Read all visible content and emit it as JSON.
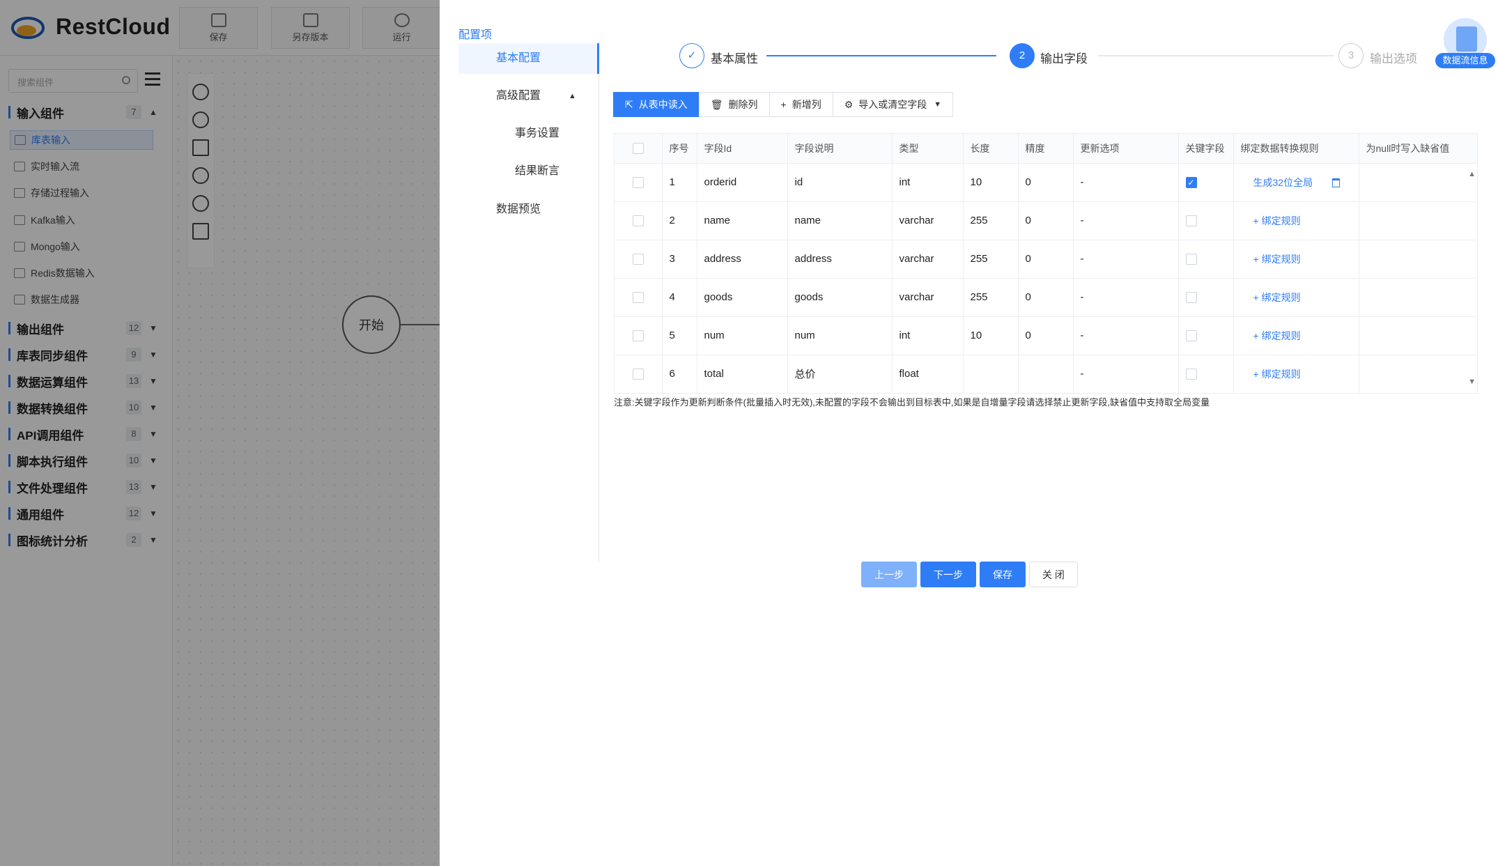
{
  "app": {
    "name": "RestCloud",
    "toolbar": [
      {
        "label": "保存",
        "icon": "save-icon"
      },
      {
        "label": "另存版本",
        "icon": "save-version-icon"
      },
      {
        "label": "运行",
        "icon": "run-icon"
      }
    ]
  },
  "sidebar": {
    "search_placeholder": "搜索组件",
    "categories": [
      {
        "name": "输入组件",
        "count": "7",
        "expanded": true,
        "items": [
          "库表输入",
          "实时输入流",
          "存储过程输入",
          "Kafka输入",
          "Mongo输入",
          "Redis数据输入",
          "数据生成器"
        ]
      },
      {
        "name": "输出组件",
        "count": "12"
      },
      {
        "name": "库表同步组件",
        "count": "9"
      },
      {
        "name": "数据运算组件",
        "count": "13"
      },
      {
        "name": "数据转换组件",
        "count": "10"
      },
      {
        "name": "API调用组件",
        "count": "8"
      },
      {
        "name": "脚本执行组件",
        "count": "10"
      },
      {
        "name": "文件处理组件",
        "count": "13"
      },
      {
        "name": "通用组件",
        "count": "12"
      },
      {
        "name": "图标统计分析",
        "count": "2"
      }
    ]
  },
  "canvas": {
    "start_node": "开始"
  },
  "drawer": {
    "title": "配置项",
    "nav": [
      "基本配置",
      "高级配置",
      "事务设置",
      "结果断言",
      "数据预览"
    ],
    "steps": [
      {
        "num": "1",
        "label": "基本属性",
        "state": "done"
      },
      {
        "num": "2",
        "label": "输出字段",
        "state": "active"
      },
      {
        "num": "3",
        "label": "输出选项",
        "state": "pending"
      }
    ],
    "actions": [
      "从表中读入",
      "删除列",
      "新增列",
      "导入或清空字段"
    ],
    "columns": [
      "序号",
      "字段Id",
      "字段说明",
      "类型",
      "长度",
      "精度",
      "更新选项",
      "关键字段",
      "绑定数据转换规则",
      "为null时写入缺省值"
    ],
    "rows": [
      {
        "no": "1",
        "id": "orderid",
        "desc": "id",
        "type": "int",
        "len": "10",
        "prec": "0",
        "upd": "-",
        "key": true,
        "rule": "生成32位全局"
      },
      {
        "no": "2",
        "id": "name",
        "desc": "name",
        "type": "varchar",
        "len": "255",
        "prec": "0",
        "upd": "-",
        "key": false,
        "rule": "绑定规则"
      },
      {
        "no": "3",
        "id": "address",
        "desc": "address",
        "type": "varchar",
        "len": "255",
        "prec": "0",
        "upd": "-",
        "key": false,
        "rule": "绑定规则"
      },
      {
        "no": "4",
        "id": "goods",
        "desc": "goods",
        "type": "varchar",
        "len": "255",
        "prec": "0",
        "upd": "-",
        "key": false,
        "rule": "绑定规则"
      },
      {
        "no": "5",
        "id": "num",
        "desc": "num",
        "type": "int",
        "len": "10",
        "prec": "0",
        "upd": "-",
        "key": false,
        "rule": "绑定规则"
      },
      {
        "no": "6",
        "id": "total",
        "desc": "总价",
        "type": "float",
        "len": "",
        "prec": "",
        "upd": "-",
        "key": false,
        "rule": "绑定规则"
      }
    ],
    "note": "注意:关键字段作为更新判断条件(批量插入时无效),未配置的字段不会输出到目标表中,如果是自增量字段请选择禁止更新字段,缺省值中支持取全局变量",
    "footer": [
      "上一步",
      "下一步",
      "保存",
      "关 闭"
    ],
    "badge": "数据流信息"
  },
  "colors": {
    "accent": "#2f7df6",
    "overlay": "rgba(0,0,0,0.40)"
  }
}
